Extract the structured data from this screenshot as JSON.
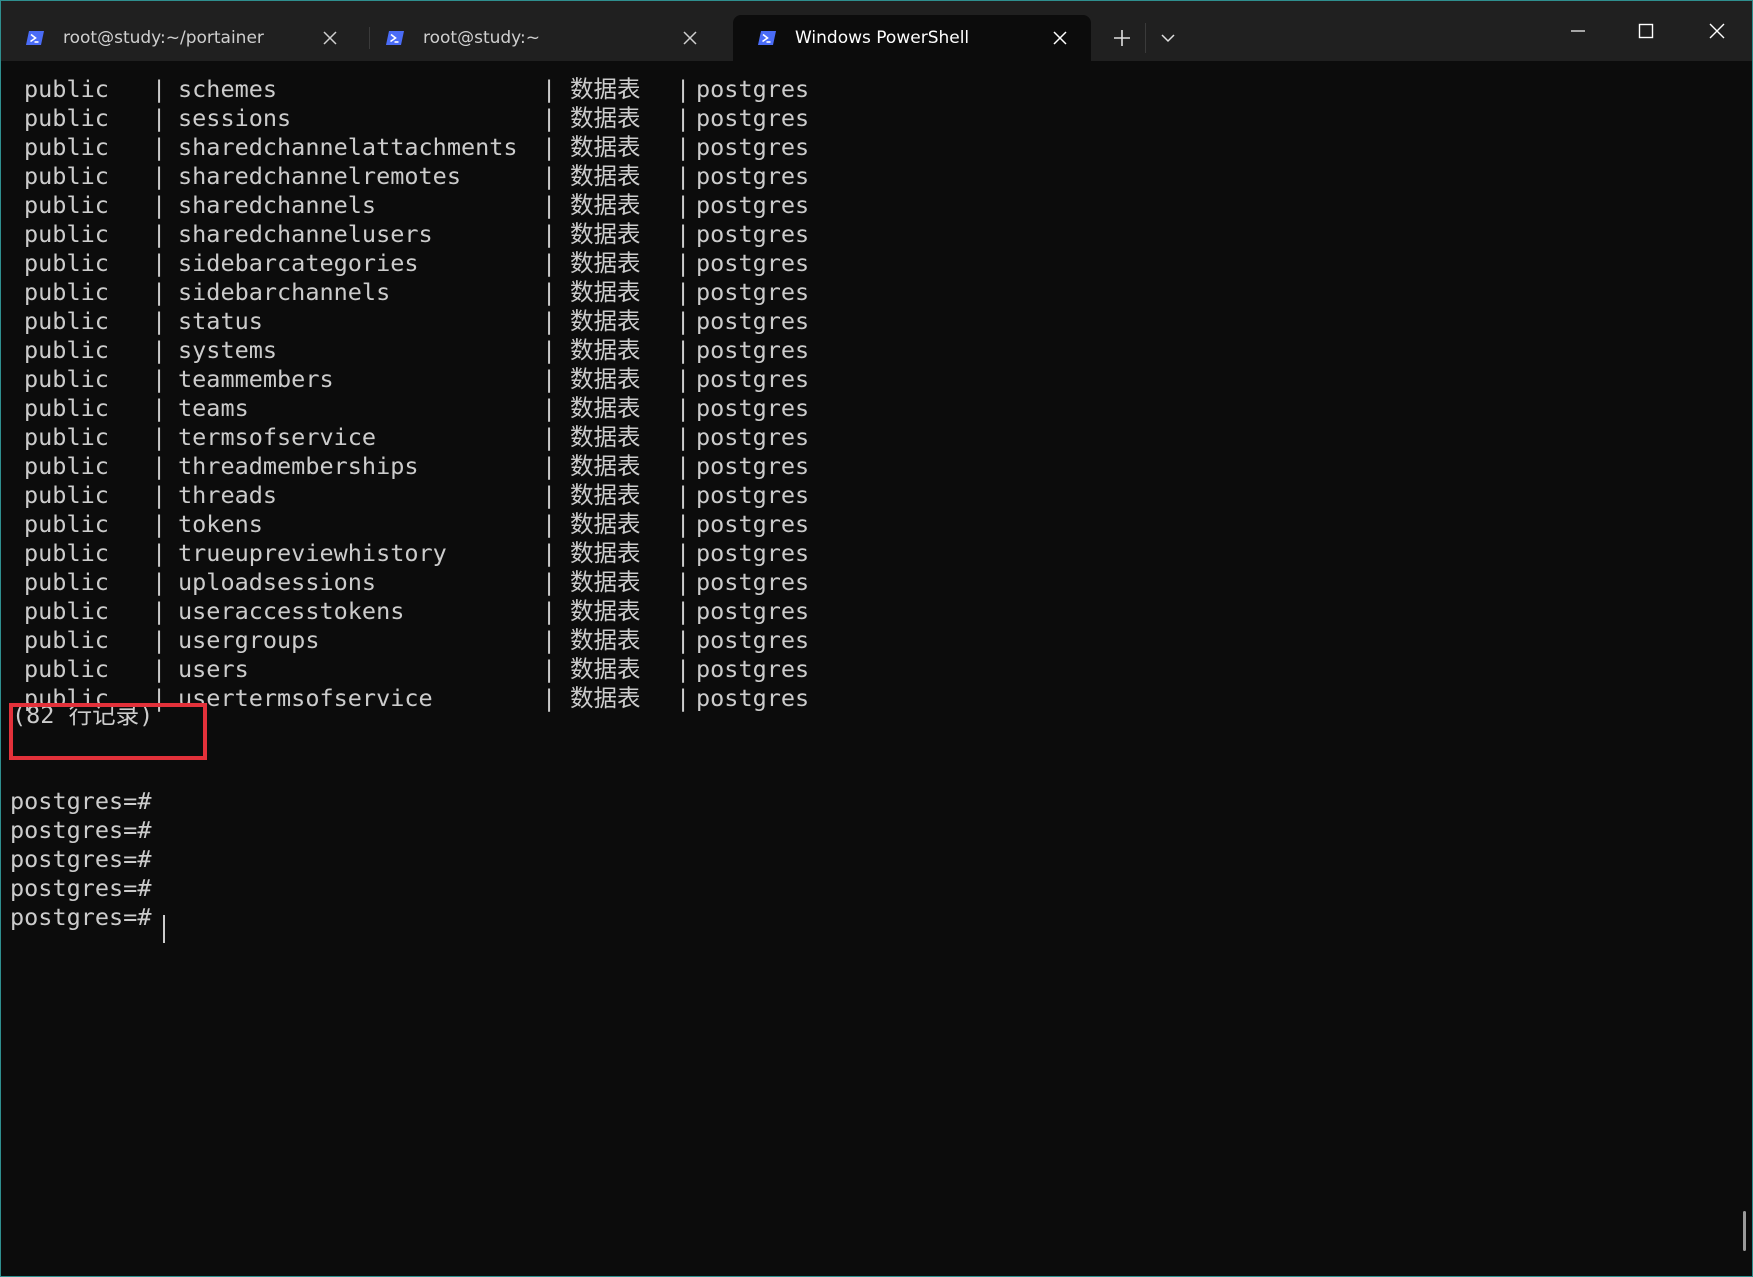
{
  "window": {
    "tabs": [
      {
        "label": "root@study:~/portainer",
        "active": false,
        "icon": "powershell-icon"
      },
      {
        "label": "root@study:~",
        "active": false,
        "icon": "powershell-icon"
      },
      {
        "label": "Windows PowerShell",
        "active": true,
        "icon": "powershell-icon"
      }
    ],
    "new_tab_icon": "plus-icon",
    "dropdown_icon": "chevron-down-icon",
    "controls": [
      "minimize-icon",
      "maximize-icon",
      "close-icon"
    ],
    "accent_color": "#4a6cf7",
    "highlight_color": "#e3313a"
  },
  "terminal": {
    "separator": "|",
    "rows": [
      {
        "schema": "public",
        "name": "schemes",
        "type": "数据表",
        "owner": "postgres"
      },
      {
        "schema": "public",
        "name": "sessions",
        "type": "数据表",
        "owner": "postgres"
      },
      {
        "schema": "public",
        "name": "sharedchannelattachments",
        "type": "数据表",
        "owner": "postgres"
      },
      {
        "schema": "public",
        "name": "sharedchannelremotes",
        "type": "数据表",
        "owner": "postgres"
      },
      {
        "schema": "public",
        "name": "sharedchannels",
        "type": "数据表",
        "owner": "postgres"
      },
      {
        "schema": "public",
        "name": "sharedchannelusers",
        "type": "数据表",
        "owner": "postgres"
      },
      {
        "schema": "public",
        "name": "sidebarcategories",
        "type": "数据表",
        "owner": "postgres"
      },
      {
        "schema": "public",
        "name": "sidebarchannels",
        "type": "数据表",
        "owner": "postgres"
      },
      {
        "schema": "public",
        "name": "status",
        "type": "数据表",
        "owner": "postgres"
      },
      {
        "schema": "public",
        "name": "systems",
        "type": "数据表",
        "owner": "postgres"
      },
      {
        "schema": "public",
        "name": "teammembers",
        "type": "数据表",
        "owner": "postgres"
      },
      {
        "schema": "public",
        "name": "teams",
        "type": "数据表",
        "owner": "postgres"
      },
      {
        "schema": "public",
        "name": "termsofservice",
        "type": "数据表",
        "owner": "postgres"
      },
      {
        "schema": "public",
        "name": "threadmemberships",
        "type": "数据表",
        "owner": "postgres"
      },
      {
        "schema": "public",
        "name": "threads",
        "type": "数据表",
        "owner": "postgres"
      },
      {
        "schema": "public",
        "name": "tokens",
        "type": "数据表",
        "owner": "postgres"
      },
      {
        "schema": "public",
        "name": "trueupreviewhistory",
        "type": "数据表",
        "owner": "postgres"
      },
      {
        "schema": "public",
        "name": "uploadsessions",
        "type": "数据表",
        "owner": "postgres"
      },
      {
        "schema": "public",
        "name": "useraccesstokens",
        "type": "数据表",
        "owner": "postgres"
      },
      {
        "schema": "public",
        "name": "usergroups",
        "type": "数据表",
        "owner": "postgres"
      },
      {
        "schema": "public",
        "name": "users",
        "type": "数据表",
        "owner": "postgres"
      },
      {
        "schema": "public",
        "name": "usertermsofservice",
        "type": "数据表",
        "owner": "postgres"
      }
    ],
    "row_count": "(82 行记录)",
    "prompts": [
      "postgres=#",
      "postgres=#",
      "postgres=#",
      "postgres=#",
      "postgres=#"
    ]
  }
}
